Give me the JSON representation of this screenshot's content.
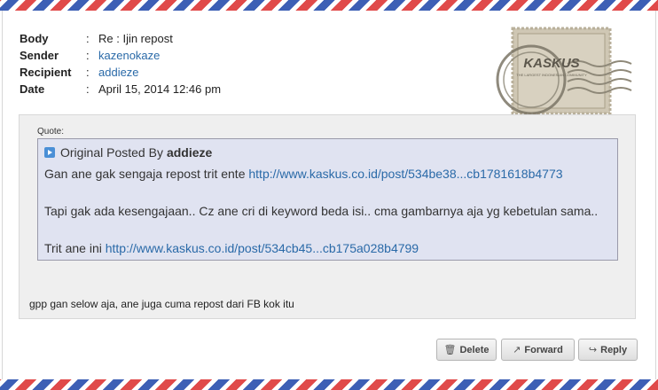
{
  "message": {
    "fields": [
      {
        "label": "Body",
        "value": "Re : Ijin repost",
        "is_link": false
      },
      {
        "label": "Sender",
        "value": "kazenokaze",
        "is_link": true
      },
      {
        "label": "Recipient",
        "value": "addieze",
        "is_link": true
      },
      {
        "label": "Date",
        "value": "April 15, 2014 12:46 pm",
        "is_link": false
      }
    ],
    "colon": ":"
  },
  "stamp": {
    "brand": "KASKUS",
    "tagline": "THE LARGEST INDONESIAN COMMUNITY"
  },
  "quote": {
    "label": "Quote:",
    "posted_by_prefix": "Original Posted By",
    "author": "addieze",
    "line1_text": "Gan ane gak sengaja repost trit ente ",
    "line1_link": "http://www.kaskus.co.id/post/534be38...cb1781618b4773",
    "line2_text": "Tapi gak ada kesengajaan.. Cz ane cri di keyword beda isi.. cma gambarnya aja yg kebetulan sama..",
    "line3_text": "Trit ane ini ",
    "line3_link": "http://www.kaskus.co.id/post/534cb45...cb175a028b4799"
  },
  "reply_text": "gpp gan selow aja, ane juga cuma repost dari FB kok itu",
  "buttons": {
    "delete": "Delete",
    "forward": "Forward",
    "reply": "Reply"
  },
  "colors": {
    "stripe_red": "#e04a4a",
    "stripe_blue": "#3d5fb5",
    "link": "#2a6aa8",
    "quote_bg": "#e0e3f1"
  }
}
